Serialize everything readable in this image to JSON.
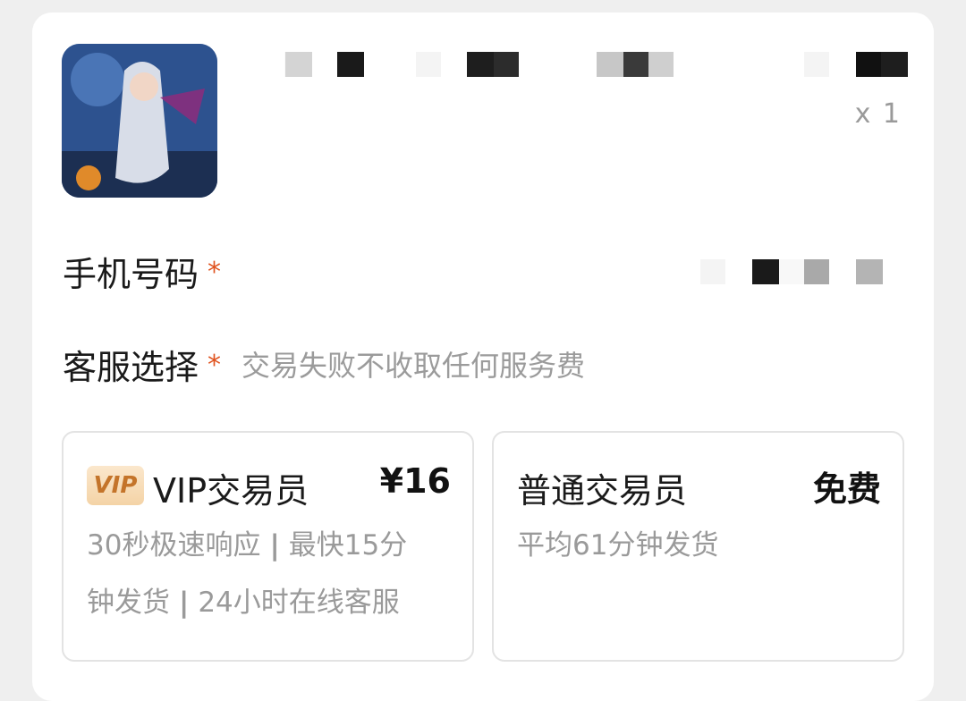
{
  "product": {
    "quantity": "x 1",
    "thumbnail": "game-character-artwork"
  },
  "phone": {
    "label": "手机号码",
    "required_mark": "*"
  },
  "service": {
    "label": "客服选择",
    "required_mark": "*",
    "hint": "交易失败不收取任何服务费",
    "options": [
      {
        "badge": "VIP",
        "title": "VIP交易员",
        "price": "¥16",
        "desc_a": "30秒极速响应",
        "desc_b": "最快15分",
        "desc_c": "钟发货",
        "desc_d": "24小时在线客服"
      },
      {
        "title": "普通交易员",
        "price": "免费",
        "desc_a": "平均61分钟发货"
      }
    ]
  },
  "colors": {
    "required": "#e0531f",
    "muted": "#9a9a9a",
    "badge_text": "#c4742a"
  }
}
